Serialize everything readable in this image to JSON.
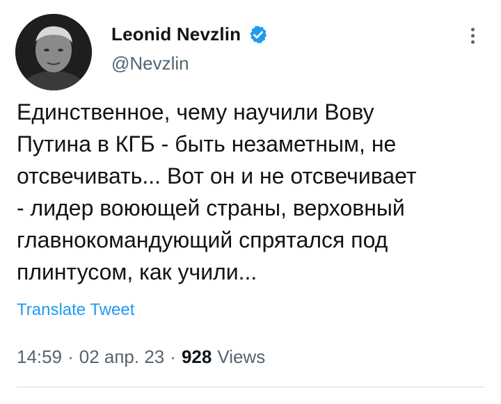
{
  "author": {
    "display_name": "Leonid Nevzlin",
    "handle": "@Nevzlin",
    "verified": true
  },
  "tweet": {
    "text": "Единственное, чему научили Вову\nПутина в КГБ - быть незаметным, не\nотсвечивать... Вот он и не отсвечивает\n- лидер воюющей страны, верховный\nглавнокомандующий спрятался под\nплинтусом, как учили...",
    "translate_label": "Translate Tweet",
    "time": "14:59",
    "separator1": "·",
    "date": "02 апр. 23",
    "separator2": "·",
    "views_count": "928",
    "views_label": "Views"
  },
  "icons": {
    "verified": "verified-badge-icon",
    "more": "more-options-icon"
  },
  "colors": {
    "accent": "#1d9bf0",
    "secondary_text": "#536471",
    "primary_text": "#0f1419"
  }
}
